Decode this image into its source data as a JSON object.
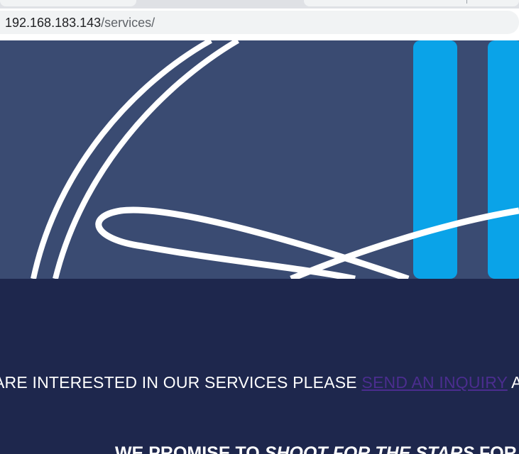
{
  "browser": {
    "url_host": "192.168.183.143",
    "url_path": "/services/"
  },
  "hero": {
    "colors": {
      "background": "#3a4b72",
      "ring": "#ffffff",
      "accent_bar": "#0aa3e8"
    }
  },
  "content": {
    "inquiry_prefix": "ARE INTERESTED IN OUR SERVICES PLEASE ",
    "inquiry_link": "SEND AN INQUIRY",
    "inquiry_suffix": " AN",
    "promise_prefix": "WE PROMISE TO ",
    "promise_emphasis": "SHOOT FOR THE STARS",
    "promise_suffix": " FOR AL"
  },
  "colors": {
    "content_background": "#1e274d",
    "link": "#4b2d8f",
    "text": "#ffffff"
  }
}
